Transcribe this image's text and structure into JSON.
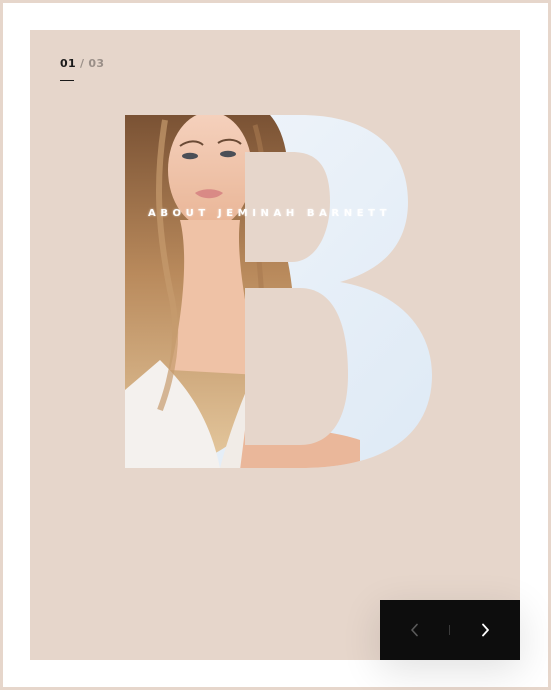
{
  "slider": {
    "current": "01",
    "separator": "/",
    "total": "03"
  },
  "hero": {
    "headline": "ABOUT JEMINAH BARNETT",
    "letter": "B"
  },
  "navigation": {
    "prev_icon": "chevron-left-icon",
    "next_icon": "chevron-right-icon"
  },
  "colors": {
    "background": "#e6d6cb",
    "frame": "#ffffff",
    "nav_background": "#0d0d0d",
    "letter_fill": "#e8f0f8"
  }
}
